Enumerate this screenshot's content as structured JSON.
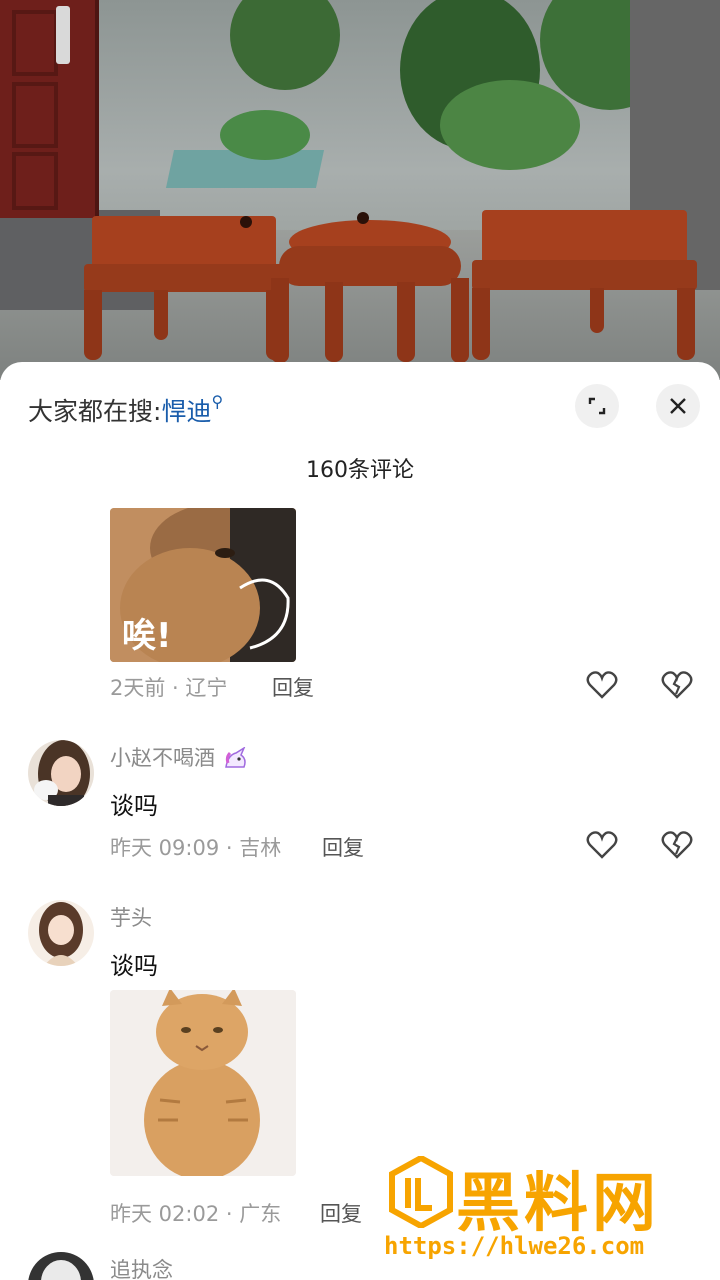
{
  "search_bar": {
    "prefix": "大家都在搜:",
    "term": "悍迪"
  },
  "comment_count": "160条评论",
  "sticker_caption": "唉!",
  "comments": [
    {
      "meta": "2天前 · 辽宁",
      "reply": "回复"
    },
    {
      "username": "小赵不喝酒",
      "text": "谈吗",
      "meta": "昨天 09:09 · 吉林",
      "reply": "回复"
    },
    {
      "username": "芋头",
      "text": "谈吗",
      "meta": "昨天 02:02 · 广东",
      "reply": "回复"
    },
    {
      "username": "追执念"
    }
  ],
  "watermark": {
    "title": "黑料网",
    "url": "https://hlwe26.com"
  },
  "colors": {
    "link": "#1a5dab",
    "watermark": "#f7a400",
    "wood": "#a6401e"
  }
}
